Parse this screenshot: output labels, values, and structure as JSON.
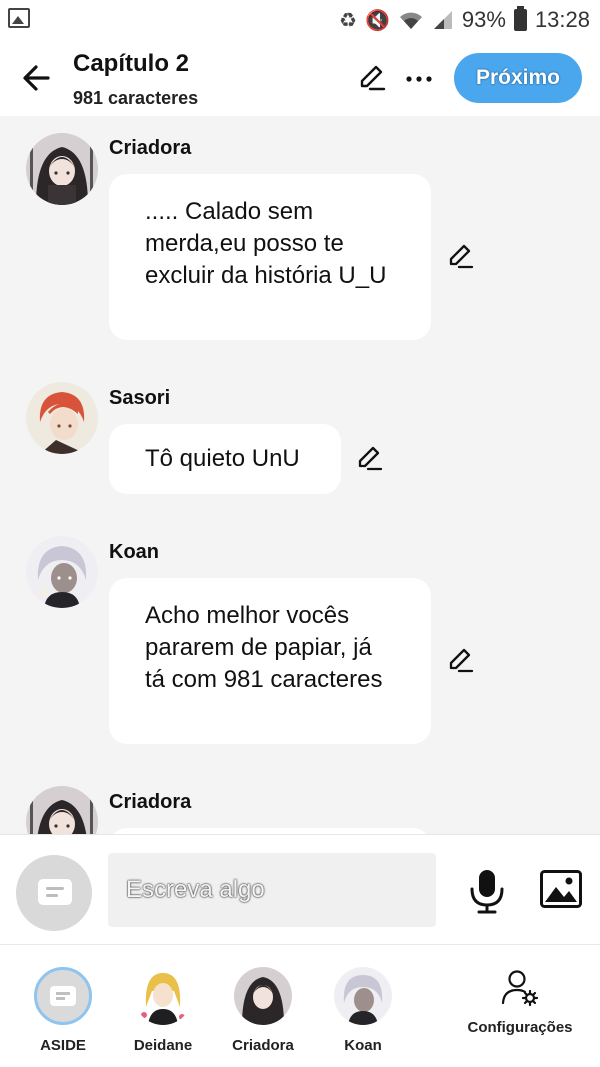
{
  "status_bar": {
    "battery": "93%",
    "time": "13:28"
  },
  "header": {
    "title": "Capítulo 2",
    "subtitle": "981 caracteres",
    "next_label": "Próximo"
  },
  "messages": [
    {
      "sender": "Criadora",
      "text": "..... Calado sem merda,eu posso te excluir da história U_U"
    },
    {
      "sender": "Sasori",
      "text": "Tô quieto UnU"
    },
    {
      "sender": "Koan",
      "text": "Acho melhor vocês pararem de papiar, já tá com 981 caracteres"
    },
    {
      "sender": "Criadora",
      "text": ""
    }
  ],
  "composer": {
    "placeholder": "Escreva algo"
  },
  "characters": [
    {
      "label": "ASIDE"
    },
    {
      "label": "Deidane"
    },
    {
      "label": "Criadora"
    },
    {
      "label": "Koan"
    }
  ],
  "settings_label": "Configurações",
  "colors": {
    "accent": "#4aa7ee",
    "background": "#f4f4f4",
    "bubble": "#ffffff"
  }
}
